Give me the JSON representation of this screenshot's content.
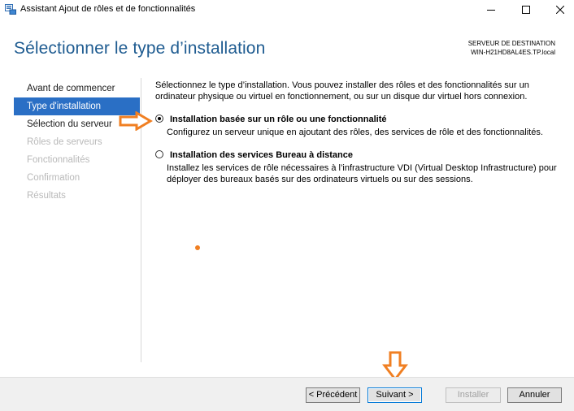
{
  "window": {
    "title": "Assistant Ajout de rôles et de fonctionnalités",
    "icon": "server-manager-icon"
  },
  "header": {
    "title": "Sélectionner le type d’installation",
    "destination_label": "SERVEUR DE DESTINATION",
    "destination_server": "WIN-H21HD8AL4ES.TP.local"
  },
  "sidebar": {
    "items": [
      {
        "label": "Avant de commencer",
        "state": "normal"
      },
      {
        "label": "Type d'installation",
        "state": "active"
      },
      {
        "label": "Sélection du serveur",
        "state": "normal"
      },
      {
        "label": "Rôles de serveurs",
        "state": "disabled"
      },
      {
        "label": "Fonctionnalités",
        "state": "disabled"
      },
      {
        "label": "Confirmation",
        "state": "disabled"
      },
      {
        "label": "Résultats",
        "state": "disabled"
      }
    ]
  },
  "main": {
    "intro": "Sélectionnez le type d’installation. Vous pouvez installer des rôles et des fonctionnalités sur un ordinateur physique ou virtuel en fonctionnement, ou sur un disque dur virtuel hors connexion.",
    "options": [
      {
        "title": "Installation basée sur un rôle ou une fonctionnalité",
        "description": "Configurez un serveur unique en ajoutant des rôles, des services de rôle et des fonctionnalités.",
        "selected": true
      },
      {
        "title": "Installation des services Bureau à distance",
        "description": "Installez les services de rôle nécessaires à l’infrastructure VDI (Virtual Desktop Infrastructure) pour déployer des bureaux basés sur des ordinateurs virtuels ou sur des sessions.",
        "selected": false
      }
    ]
  },
  "footer": {
    "previous_label": "< Précédent",
    "next_label": "Suivant >",
    "install_label": "Installer",
    "cancel_label": "Annuler"
  },
  "colors": {
    "title_blue": "#1f5c91",
    "active_nav": "#2a6fc5",
    "annotation_orange": "#f07f22"
  }
}
